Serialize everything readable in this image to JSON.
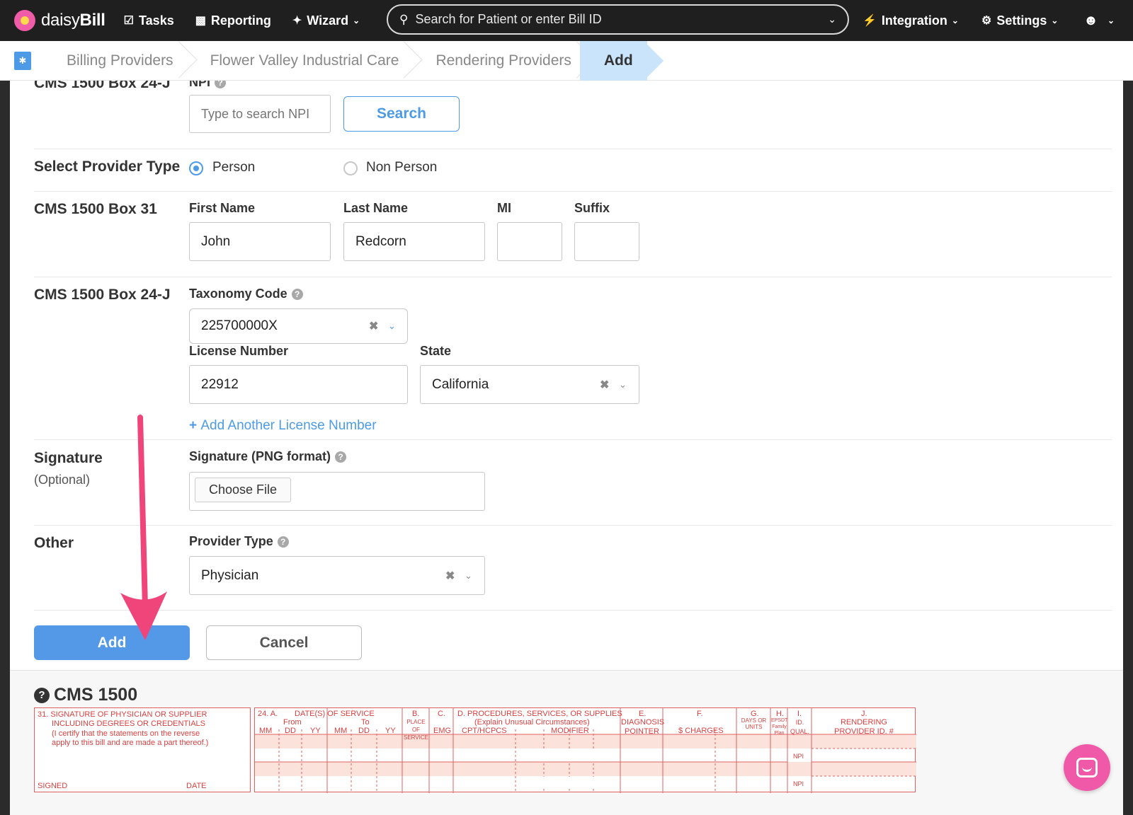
{
  "nav": {
    "brand_plain": "daisy",
    "brand_bold": "Bill",
    "tasks": "Tasks",
    "reporting": "Reporting",
    "wizard": "Wizard",
    "search_placeholder": "Search for Patient or enter Bill ID",
    "integration": "Integration",
    "settings": "Settings"
  },
  "breadcrumb": {
    "home_icon": "provider-card-icon",
    "items": [
      "Billing Providers",
      "Flower Valley Industrial Care",
      "Rendering Providers",
      "Add"
    ]
  },
  "form": {
    "npi_section_label": "CMS 1500 Box 24-J",
    "npi_label": "NPI",
    "npi_placeholder": "Type to search NPI",
    "search_button": "Search",
    "provider_type_label": "Select Provider Type",
    "provider_type_options": [
      "Person",
      "Non Person"
    ],
    "provider_type_selected": "Person",
    "box31_label": "CMS 1500 Box 31",
    "first_name_label": "First Name",
    "first_name": "John",
    "last_name_label": "Last Name",
    "last_name": "Redcorn",
    "mi_label": "MI",
    "mi": "",
    "suffix_label": "Suffix",
    "suffix": "",
    "box24j_label": "CMS 1500 Box 24-J",
    "taxonomy_label": "Taxonomy Code",
    "taxonomy_value": "225700000X",
    "license_label": "License Number",
    "license_value": "22912",
    "state_label": "State",
    "state_value": "California",
    "add_license_link": "Add Another License Number",
    "signature_section": "Signature",
    "signature_optional": "(Optional)",
    "signature_label": "Signature (PNG format)",
    "choose_file": "Choose File",
    "other_section": "Other",
    "provider_type_field_label": "Provider Type",
    "provider_type_value": "Physician",
    "add_button": "Add",
    "cancel_button": "Cancel"
  },
  "cms1500": {
    "title": "CMS 1500",
    "box31_text": [
      "31. SIGNATURE OF PHYSICIAN OR SUPPLIER",
      "INCLUDING DEGREES OR CREDENTIALS",
      "(I certify that the statements on the reverse",
      "apply to this bill and are made a part thereof.)"
    ],
    "signed": "SIGNED",
    "date": "DATE",
    "col_24a": "24. A.",
    "col_dates": "DATE(S) OF SERVICE",
    "from": "From",
    "to": "To",
    "mm": "MM",
    "dd": "DD",
    "yy": "YY",
    "col_b": "B.",
    "place_of_service": "PLACE OF SERVICE",
    "col_c": "C.",
    "emg": "EMG",
    "col_d": "D. PROCEDURES, SERVICES, OR SUPPLIES",
    "explain": "(Explain Unusual Circumstances)",
    "cpt": "CPT/HCPCS",
    "modifier": "MODIFIER",
    "col_e": "E.",
    "diagnosis_pointer": "DIAGNOSIS POINTER",
    "col_f": "F.",
    "charges": "$ CHARGES",
    "col_g": "G.",
    "days_units": "DAYS OR UNITS",
    "col_h": "H.",
    "epsdt": "EPSDT Family Plan",
    "col_i": "I.",
    "id_qual": "ID. QUAL.",
    "col_j": "J.",
    "rendering_provider": "RENDERING PROVIDER ID. #",
    "npi": "NPI"
  },
  "colors": {
    "accent": "#4d9be6",
    "primary_button": "#5499e8",
    "annotation_arrow": "#f0457a",
    "form_red": "#e06060",
    "chat_pink": "#f058a8"
  }
}
